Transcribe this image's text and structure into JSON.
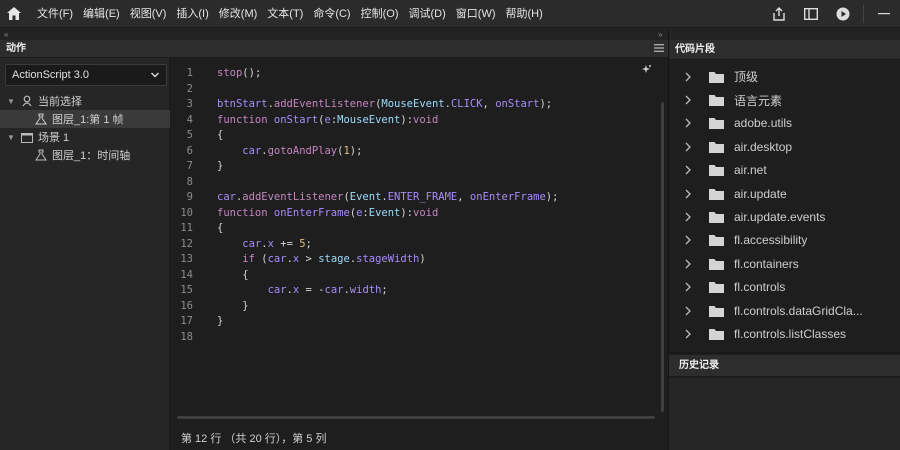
{
  "menubar": {
    "items": [
      "文件(F)",
      "编辑(E)",
      "视图(V)",
      "插入(I)",
      "修改(M)",
      "文本(T)",
      "命令(C)",
      "控制(O)",
      "调试(D)",
      "窗口(W)",
      "帮助(H)"
    ],
    "right_icons": [
      "share-icon",
      "panel-layout-icon",
      "play-icon",
      "minimize-icon"
    ]
  },
  "actions_panel": {
    "tab_label": "动作",
    "language_select": "ActionScript 3.0",
    "tree": [
      {
        "label": "当前选择",
        "level": 0,
        "icon": "current-selection-icon",
        "expanded": true
      },
      {
        "label": "图层_1:第 1 帧",
        "level": 1,
        "icon": "actionscript-icon",
        "selected": true
      },
      {
        "label": "场景 1",
        "level": 0,
        "icon": "scene-icon",
        "expanded": true
      },
      {
        "label": "图层_1：时间轴",
        "level": 1,
        "icon": "actionscript-icon"
      }
    ]
  },
  "editor": {
    "line_numbers": [
      "1",
      "2",
      "3",
      "4",
      "5",
      "6",
      "7",
      "8",
      "9",
      "10",
      "11",
      "12",
      "13",
      "14",
      "15",
      "16",
      "17",
      "18"
    ],
    "status": "第 12 行 （共 20 行），第 5 列"
  },
  "code_snippets": {
    "tab_label": "代码片段",
    "items": [
      "顶级",
      "语言元素",
      "adobe.utils",
      "air.desktop",
      "air.net",
      "air.update",
      "air.update.events",
      "fl.accessibility",
      "fl.containers",
      "fl.controls",
      "fl.controls.dataGridCla...",
      "fl.controls.listClasses"
    ]
  },
  "history": {
    "tab_label": "历史记录"
  },
  "colors": {
    "function_purple": "#c586c0",
    "identifier_violet": "#a78bfa",
    "class_blue": "#9cdcfe",
    "number_yellow": "#e5c07b"
  }
}
